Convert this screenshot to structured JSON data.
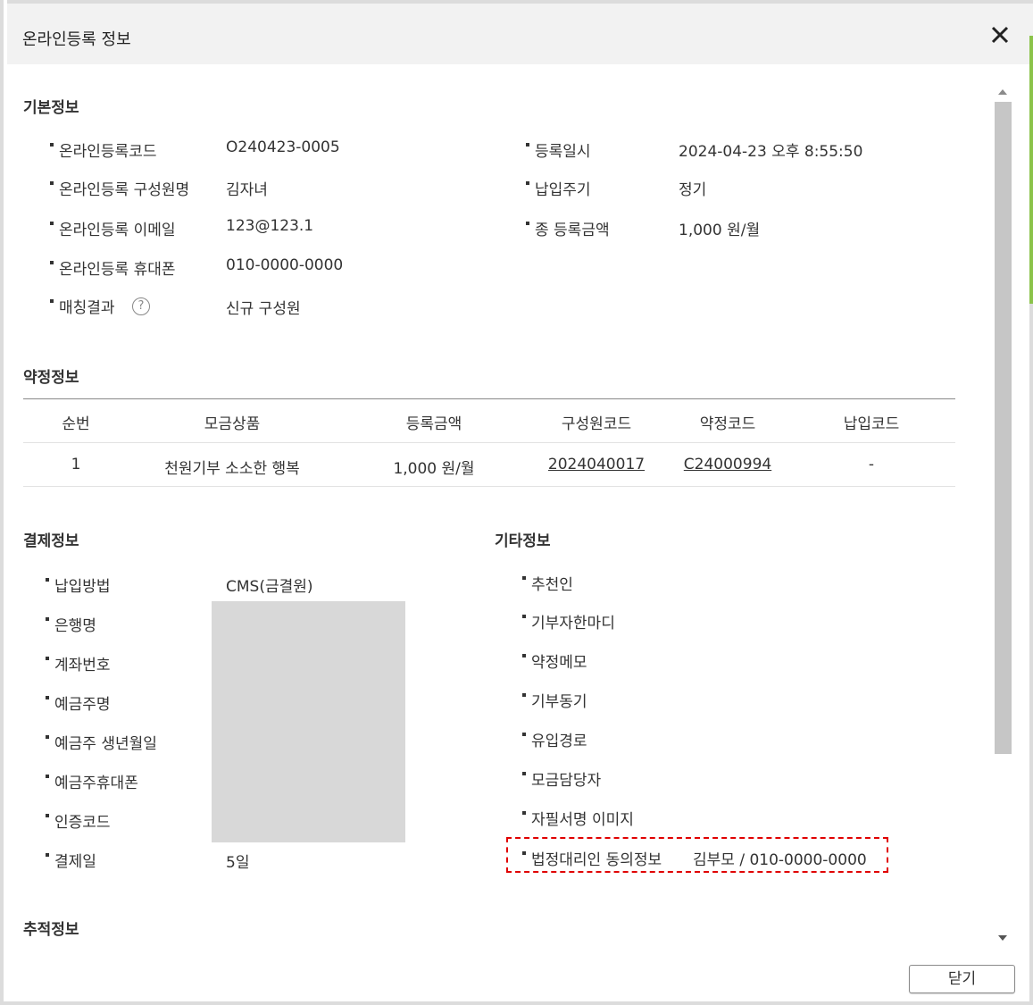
{
  "dialog": {
    "title": "온라인등록 정보",
    "close_icon": "close-icon",
    "close_button_label": "닫기"
  },
  "basic_info": {
    "title": "기본정보",
    "left": [
      {
        "label": "온라인등록코드",
        "value": "O240423-0005"
      },
      {
        "label": "온라인등록 구성원명",
        "value": "김자녀"
      },
      {
        "label": "온라인등록 이메일",
        "value": "123@123.1"
      },
      {
        "label": "온라인등록 휴대폰",
        "value": "010-0000-0000"
      },
      {
        "label": "매칭결과",
        "value": "신규 구성원",
        "help_icon": "?"
      }
    ],
    "right": [
      {
        "label": "등록일시",
        "value": "2024-04-23 오후 8:55:50"
      },
      {
        "label": "납입주기",
        "value": "정기"
      },
      {
        "label": "종 등록금액",
        "value": "1,000 원/월"
      }
    ]
  },
  "pledge_info": {
    "title": "약정정보",
    "columns": [
      "순번",
      "모금상품",
      "등록금액",
      "구성원코드",
      "약정코드",
      "납입코드"
    ],
    "rows": [
      [
        "1",
        "천원기부 소소한 행복",
        "1,000 원/월",
        "2024040017",
        "C24000994",
        "-"
      ]
    ]
  },
  "payment_info": {
    "title": "결제정보",
    "items": [
      {
        "label": "납입방법",
        "value": "CMS(금결원)"
      },
      {
        "label": "은행명",
        "value": ""
      },
      {
        "label": "계좌번호",
        "value": ""
      },
      {
        "label": "예금주명",
        "value": ""
      },
      {
        "label": "예금주 생년월일",
        "value": ""
      },
      {
        "label": "예금주휴대폰",
        "value": ""
      },
      {
        "label": "인증코드",
        "value": ""
      },
      {
        "label": "결제일",
        "value": "5일"
      }
    ]
  },
  "other_info": {
    "title": "기타정보",
    "items": [
      {
        "label": "추천인",
        "value": ""
      },
      {
        "label": "기부자한마디",
        "value": ""
      },
      {
        "label": "약정메모",
        "value": ""
      },
      {
        "label": "기부동기",
        "value": ""
      },
      {
        "label": "유입경로",
        "value": ""
      },
      {
        "label": "모금담당자",
        "value": ""
      },
      {
        "label": "자필서명 이미지",
        "value": ""
      },
      {
        "label": "법정대리인 동의정보",
        "value": "김부모 / 010-0000-0000"
      }
    ]
  },
  "tracking_info": {
    "title": "추적정보"
  },
  "colors": {
    "header_bg": "#f2f2f2",
    "highlight_border": "#e00000",
    "masked_block": "#d8d8d8",
    "scroll_thumb": "#c6c6c6"
  }
}
